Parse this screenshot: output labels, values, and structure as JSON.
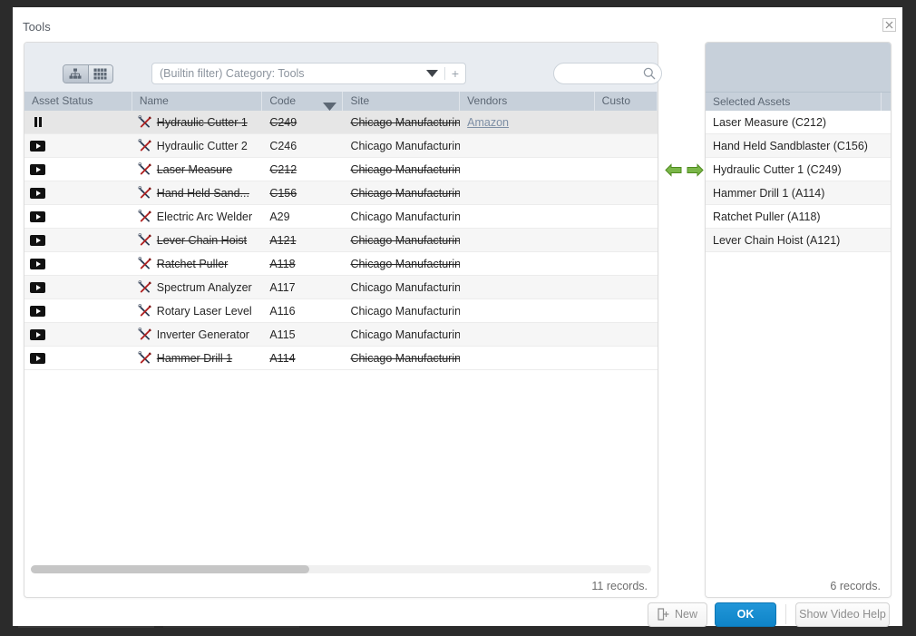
{
  "dialog": {
    "title": "Tools",
    "close_label": "×"
  },
  "toolbar": {
    "view_tree_icon": "hierarchy-icon",
    "view_grid_icon": "grid-icon",
    "filter_value": "(Builtin filter) Category: Tools",
    "filter_caret_icon": "chevron-down-icon",
    "add_filter_label": "+",
    "search_value": "",
    "search_placeholder": "",
    "search_icon": "search-icon"
  },
  "grid": {
    "columns": [
      {
        "key": "status",
        "label": "Asset Status",
        "sorted": false
      },
      {
        "key": "name",
        "label": "Name",
        "sorted": false
      },
      {
        "key": "code",
        "label": "Code",
        "sorted": true
      },
      {
        "key": "site",
        "label": "Site",
        "sorted": false
      },
      {
        "key": "vendors",
        "label": "Vendors",
        "sorted": false
      },
      {
        "key": "customer",
        "label": "Custo",
        "sorted": false
      }
    ],
    "sort_caret_icon": "sort-descending-caret-icon",
    "rows": [
      {
        "status": "pause",
        "name": "Hydraulic Cutter 1",
        "code": "C249",
        "site": "Chicago Manufacturing Ce...",
        "vendors": "Amazon",
        "selected": true,
        "strike": true
      },
      {
        "status": "play",
        "name": "Hydraulic Cutter 2",
        "code": "C246",
        "site": "Chicago Manufacturing Ce...",
        "vendors": "",
        "selected": false,
        "strike": false
      },
      {
        "status": "play",
        "name": "Laser Measure",
        "code": "C212",
        "site": "Chicago Manufacturing Ce...",
        "vendors": "",
        "selected": false,
        "strike": true
      },
      {
        "status": "play",
        "name": "Hand Held Sand...",
        "code": "C156",
        "site": "Chicago Manufacturing Ce...",
        "vendors": "",
        "selected": false,
        "strike": true
      },
      {
        "status": "play",
        "name": "Electric Arc Welder",
        "code": "A29",
        "site": "Chicago Manufacturing Ce...",
        "vendors": "",
        "selected": false,
        "strike": false
      },
      {
        "status": "play",
        "name": "Lever Chain Hoist",
        "code": "A121",
        "site": "Chicago Manufacturing Ce...",
        "vendors": "",
        "selected": false,
        "strike": true
      },
      {
        "status": "play",
        "name": "Ratchet Puller",
        "code": "A118",
        "site": "Chicago Manufacturing Ce...",
        "vendors": "",
        "selected": false,
        "strike": true
      },
      {
        "status": "play",
        "name": "Spectrum Analyzer",
        "code": "A117",
        "site": "Chicago Manufacturing Ce...",
        "vendors": "",
        "selected": false,
        "strike": false
      },
      {
        "status": "play",
        "name": "Rotary Laser Level",
        "code": "A116",
        "site": "Chicago Manufacturing Ce...",
        "vendors": "",
        "selected": false,
        "strike": false
      },
      {
        "status": "play",
        "name": "Inverter Generator",
        "code": "A115",
        "site": "Chicago Manufacturing Ce...",
        "vendors": "",
        "selected": false,
        "strike": false
      },
      {
        "status": "play",
        "name": "Hammer Drill 1",
        "code": "A114",
        "site": "Chicago Manufacturing Ce...",
        "vendors": "",
        "selected": false,
        "strike": true
      }
    ],
    "records_label": "11 records."
  },
  "transfer": {
    "move_left_icon": "arrow-left-icon",
    "move_right_icon": "arrow-right-icon"
  },
  "selected_panel": {
    "header": "Selected Assets",
    "items": [
      {
        "label": "Laser Measure (C212)"
      },
      {
        "label": "Hand Held Sandblaster (C156)"
      },
      {
        "label": "Hydraulic Cutter 1 (C249)"
      },
      {
        "label": "Hammer Drill 1 (A114)"
      },
      {
        "label": "Ratchet Puller (A118)"
      },
      {
        "label": "Lever Chain Hoist (A121)"
      }
    ],
    "records_label": "6 records."
  },
  "footer": {
    "new_label": "New",
    "new_icon": "add-document-icon",
    "ok_label": "OK",
    "help_label": "Show Video Help"
  },
  "colors": {
    "accent": "#0f84c8",
    "header_bg": "#c7d0da",
    "toolbar_bg": "#e8ecf1",
    "arrow_green": "#6db33f",
    "backdrop": "#2b2b2b"
  }
}
